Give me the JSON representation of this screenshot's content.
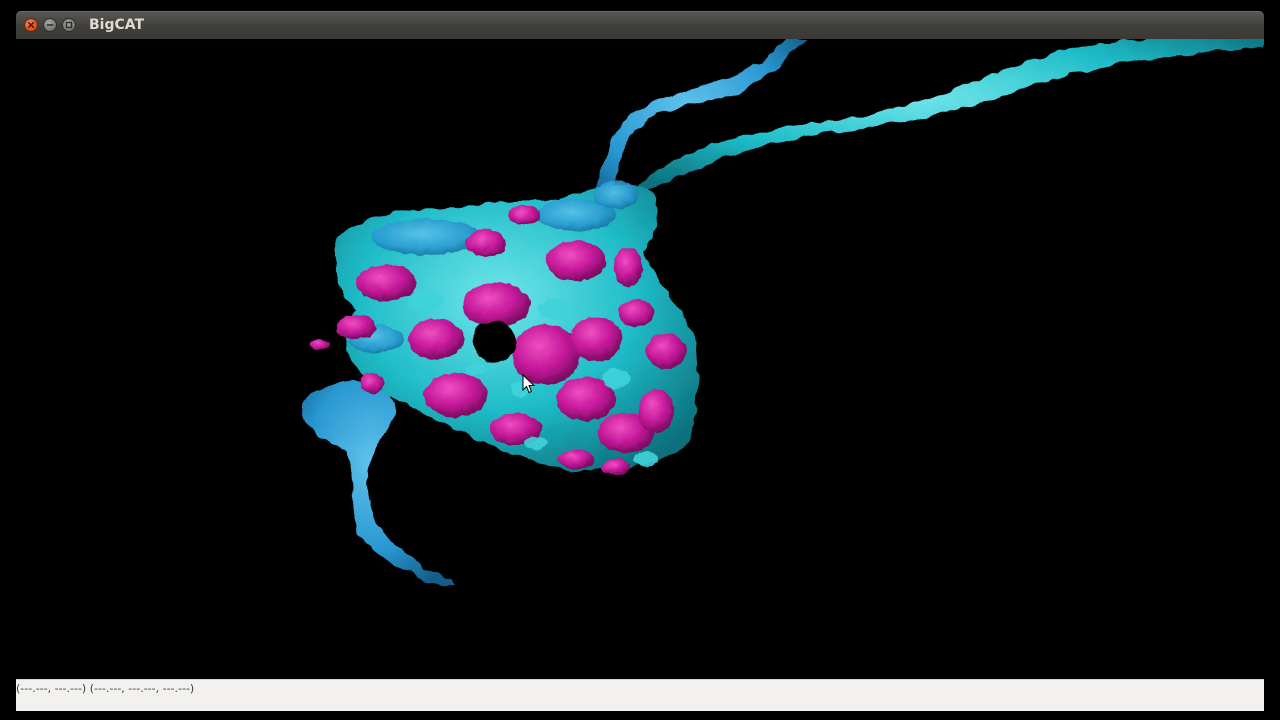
{
  "window": {
    "title": "BigCAT",
    "buttons": [
      {
        "name": "close",
        "icon": "close-icon"
      },
      {
        "name": "minimize",
        "icon": "minimize-icon"
      },
      {
        "name": "maximize",
        "icon": "maximize-icon"
      }
    ]
  },
  "viewer": {
    "background": "#000000",
    "colors": {
      "neurite_a": "#1fc6cf",
      "neurite_b": "#2a9fd6",
      "synapse": "#c2188f"
    }
  },
  "status": {
    "coordinates": "(---.---, ---.---) (---.---, ---.---, ---.---)"
  }
}
